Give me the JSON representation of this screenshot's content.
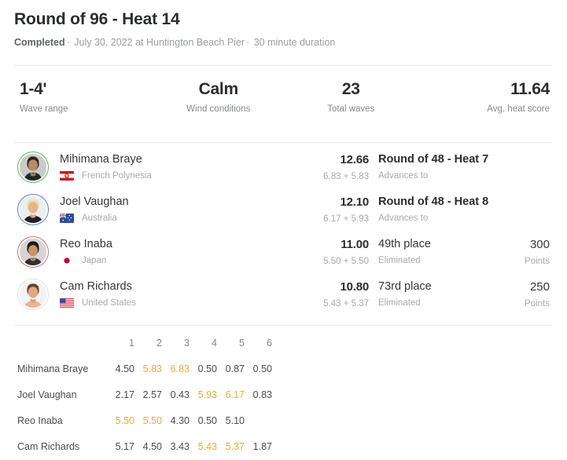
{
  "header": {
    "title": "Round of 96 - Heat 14",
    "status": "Completed",
    "date": "July 30, 2022",
    "location": "at Huntington Beach Pier",
    "duration": "30 minute duration",
    "separator": "·"
  },
  "stats": [
    {
      "value": "1-4'",
      "label": "Wave range"
    },
    {
      "value": "Calm",
      "label": "Wind conditions"
    },
    {
      "value": "23",
      "label": "Total waves"
    },
    {
      "value": "11.64",
      "label": "Avg. heat score"
    }
  ],
  "colors": {
    "rank_1_ring": "#57bb4e",
    "rank_2_ring": "#5b7fd4",
    "rank_3_ring": "#e0706f",
    "rank_4_ring": "#e2e3e5",
    "counted_wave": "#efa93b",
    "text_primary": "#2b2c2f",
    "text_muted": "#a7a9ad"
  },
  "surfers": [
    {
      "name": "Mihimana Braye",
      "country": "French Polynesia",
      "flag_icon": "flag-french-polynesia-icon",
      "total": "12.66",
      "breakdown": "6.83 + 5.83",
      "result": "Round of 48 - Heat 7",
      "result_sub": "Advances to",
      "points": "",
      "points_label": "",
      "rank": 1
    },
    {
      "name": "Joel Vaughan",
      "country": "Australia",
      "flag_icon": "flag-australia-icon",
      "total": "12.10",
      "breakdown": "6.17 + 5.93",
      "result": "Round of 48 - Heat 8",
      "result_sub": "Advances to",
      "points": "",
      "points_label": "",
      "rank": 2
    },
    {
      "name": "Reo Inaba",
      "country": "Japan",
      "flag_icon": "flag-japan-icon",
      "total": "11.00",
      "breakdown": "5.50 + 5.50",
      "result": "49th place",
      "result_sub": "Eliminated",
      "points": "300",
      "points_label": "Points",
      "rank": 3
    },
    {
      "name": "Cam Richards",
      "country": "United States",
      "flag_icon": "flag-united-states-icon",
      "total": "10.80",
      "breakdown": "5.43 + 5.37",
      "result": "73rd place",
      "result_sub": "Eliminated",
      "points": "250",
      "points_label": "Points",
      "rank": 4
    }
  ],
  "wave_table": {
    "columns": [
      "1",
      "2",
      "3",
      "4",
      "5",
      "6"
    ],
    "rows": [
      {
        "name": "Mihimana Braye",
        "scores": [
          "4.50",
          "5.83",
          "6.83",
          "0.50",
          "0.87",
          "0.50"
        ],
        "counted": [
          false,
          true,
          true,
          false,
          false,
          false
        ]
      },
      {
        "name": "Joel Vaughan",
        "scores": [
          "2.17",
          "2.57",
          "0.43",
          "5.93",
          "6.17",
          "0.83"
        ],
        "counted": [
          false,
          false,
          false,
          true,
          true,
          false
        ]
      },
      {
        "name": "Reo Inaba",
        "scores": [
          "5.50",
          "5.50",
          "4.30",
          "0.50",
          "5.10",
          ""
        ],
        "counted": [
          true,
          true,
          false,
          false,
          false,
          false
        ]
      },
      {
        "name": "Cam Richards",
        "scores": [
          "5.17",
          "4.50",
          "3.43",
          "5.43",
          "5.37",
          "1.87"
        ],
        "counted": [
          false,
          false,
          false,
          true,
          true,
          false
        ]
      }
    ]
  }
}
